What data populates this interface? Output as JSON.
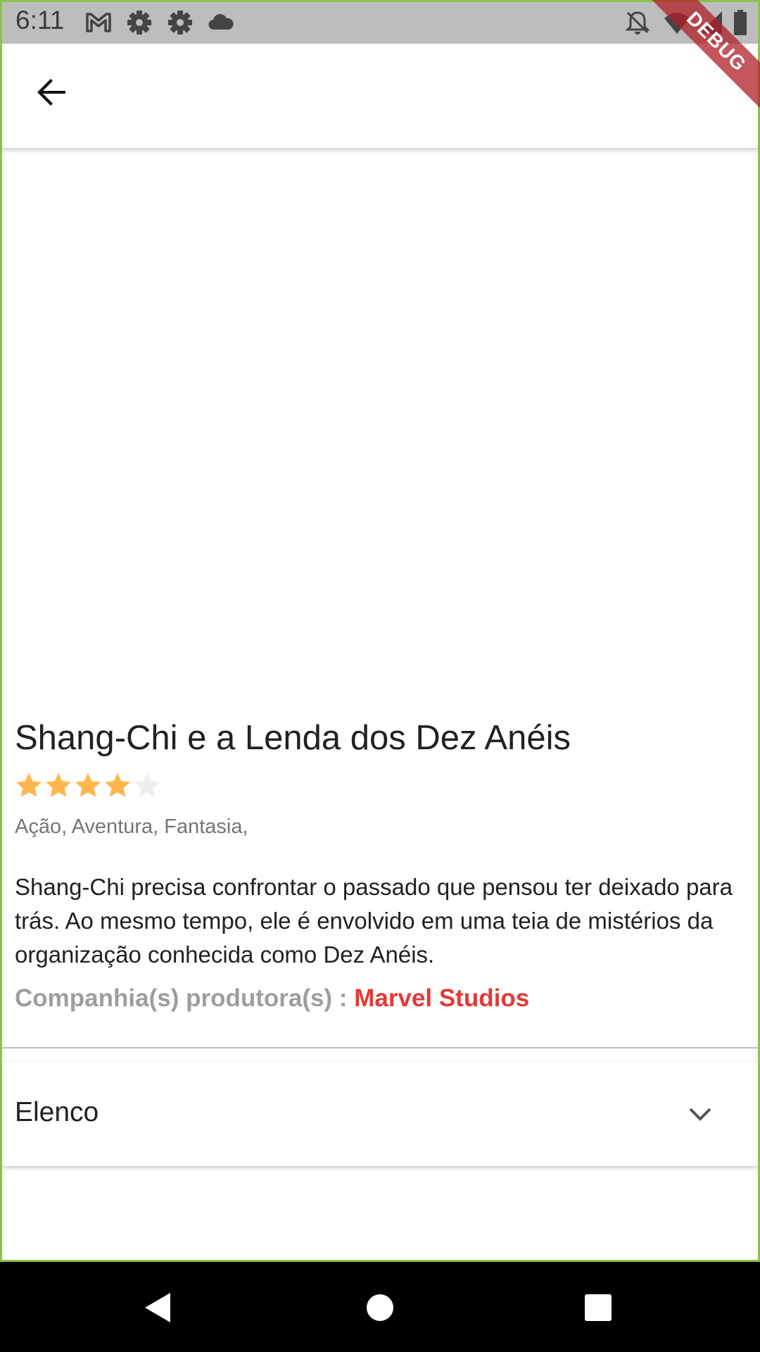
{
  "status_bar": {
    "time": "6:11",
    "icons": [
      "gmail-icon",
      "settings-icon",
      "settings-icon",
      "cloud-icon",
      "notifications-off-icon",
      "wifi-icon",
      "signal-icon",
      "battery-icon"
    ]
  },
  "debug_banner": {
    "label": "DEBUG"
  },
  "app_bar": {
    "back_icon": "arrow-back-icon"
  },
  "movie": {
    "title": "Shang-Chi e a Lenda dos Dez Anéis",
    "rating": {
      "value": 4,
      "max": 5,
      "filled_color": "#ffb74d",
      "empty_color": "#eeeeee"
    },
    "genres": "Ação, Aventura, Fantasia,",
    "overview": "Shang-Chi precisa confrontar o passado que pensou ter deixado para trás. Ao mesmo tempo, ele é envolvido em uma teia de mistérios da organização conhecida como Dez Anéis.",
    "companies_label": "Companhia(s) produtora(s) : ",
    "companies_value": "Marvel Studios"
  },
  "cast_section": {
    "title": "Elenco",
    "chevron_icon": "chevron-down-icon"
  },
  "colors": {
    "accent_red": "#e53935",
    "frame_green": "#8bc34a",
    "status_bar": "#bdbdbd"
  },
  "nav_bar": {
    "buttons": [
      "back-triangle-icon",
      "home-circle-icon",
      "recents-square-icon"
    ]
  }
}
